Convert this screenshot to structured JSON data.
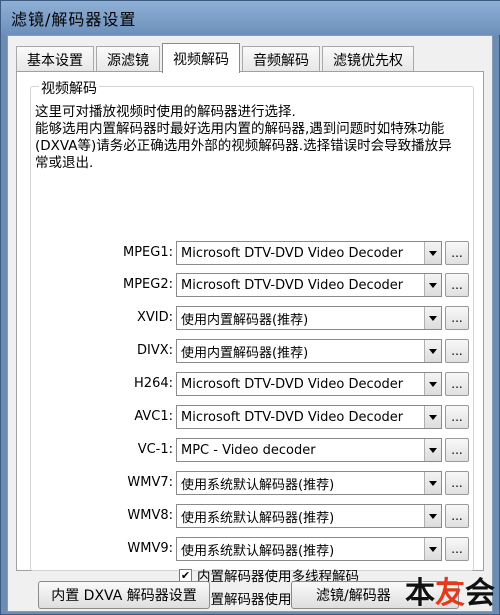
{
  "window": {
    "title": "滤镜/解码器设置"
  },
  "tabs": [
    {
      "label": "基本设置",
      "active": false
    },
    {
      "label": "源滤镜",
      "active": false
    },
    {
      "label": "视频解码",
      "active": true
    },
    {
      "label": "音频解码",
      "active": false
    },
    {
      "label": "滤镜优先权",
      "active": false
    }
  ],
  "group": {
    "title": "视频解码",
    "description": "这里可对播放视频时使用的解码器进行选择.\n能够选用内置解码器时最好选用内置的解码器,遇到问题时如特殊功能(DXVA等)请务必正确选用外部的视频解码器.选择错误时会导致播放异常或退出."
  },
  "decoders": [
    {
      "label": "MPEG1:",
      "value": "Microsoft DTV-DVD Video Decoder"
    },
    {
      "label": "MPEG2:",
      "value": "Microsoft DTV-DVD Video Decoder"
    },
    {
      "label": "XVID:",
      "value": "使用内置解码器(推荐)"
    },
    {
      "label": "DIVX:",
      "value": "使用内置解码器(推荐)"
    },
    {
      "label": "H264:",
      "value": "Microsoft DTV-DVD Video Decoder"
    },
    {
      "label": "AVC1:",
      "value": "Microsoft DTV-DVD Video Decoder"
    },
    {
      "label": "VC-1:",
      "value": "MPC - Video decoder"
    },
    {
      "label": "WMV7:",
      "value": "使用系统默认解码器(推荐)"
    },
    {
      "label": "WMV8:",
      "value": "使用系统默认解码器(推荐)"
    },
    {
      "label": "WMV9:",
      "value": "使用系统默认解码器(推荐)"
    }
  ],
  "more_label": "...",
  "checkboxes": [
    {
      "label": "内置解码器使用多线程解码",
      "checked": true
    },
    {
      "label": "内置解码器使用队列输出(Queue)",
      "checked": true
    }
  ],
  "buttons": {
    "dxva_settings": "内置 DXVA 解码器设置",
    "filter_decoder": "滤镜/解码器"
  },
  "watermark": {
    "part1": "本",
    "part2": "友",
    "part3": "会"
  }
}
